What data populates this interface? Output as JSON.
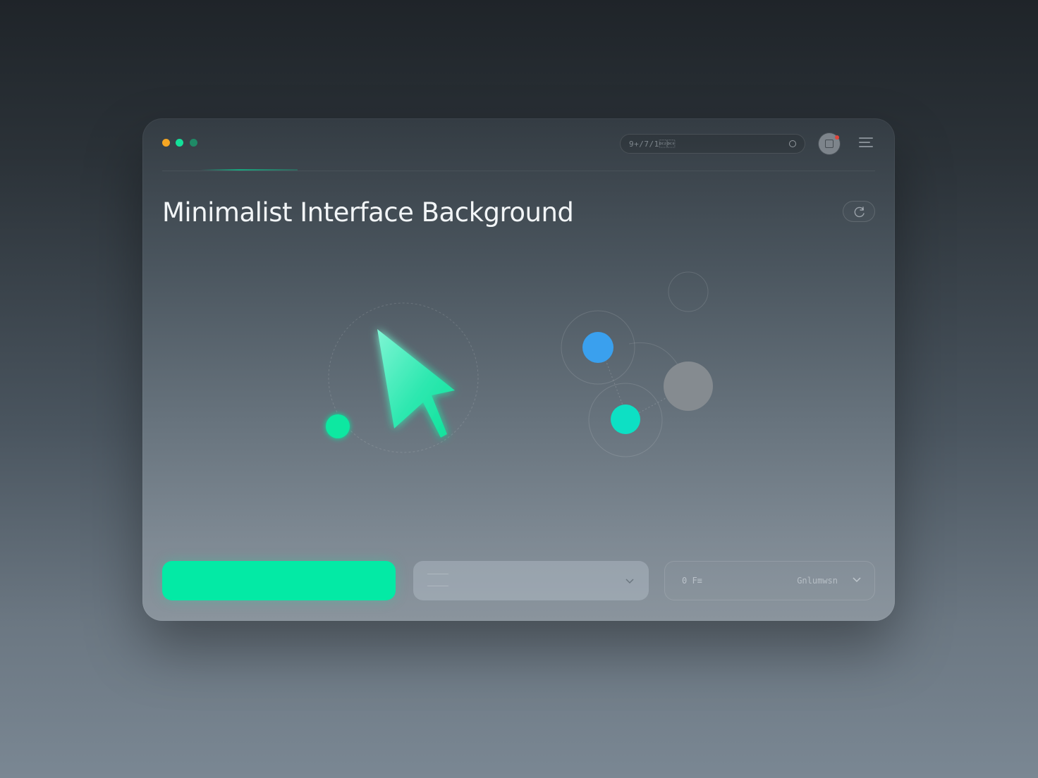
{
  "window": {
    "dots": [
      {
        "name": "orange",
        "color": "#f5a623"
      },
      {
        "name": "green",
        "color": "#14e09a"
      },
      {
        "name": "dark-green",
        "color": "#1f8a66"
      }
    ]
  },
  "header": {
    "search": {
      "value": "9+/7/1\u0012\u0013",
      "display": "9ᴴ/7/1▯▯3",
      "icon": "search-icon"
    },
    "avatar_icon": "avatar-icon",
    "menu_icon": "menu-icon"
  },
  "main": {
    "title": "Minimalist Interface Background",
    "refresh_icon": "refresh-icon"
  },
  "illustration": {
    "cursor_color": "#19e8a8",
    "nodes": [
      {
        "name": "blue-node",
        "color": "#3aa0ee"
      },
      {
        "name": "teal-node",
        "color": "#0de0c4"
      },
      {
        "name": "gray-node",
        "color": "#858b90"
      },
      {
        "name": "green-dot",
        "color": "#0fe8a1"
      }
    ]
  },
  "controls": {
    "primary_button_label": "",
    "select": {
      "value": "",
      "chevron": "chevron-down-icon"
    },
    "filter": {
      "code": "0 F≡",
      "label": "Gnlumwsn",
      "chevron": "chevron-down-icon"
    }
  },
  "colors": {
    "accent": "#03eaa5",
    "blue": "#3aa0ee",
    "teal": "#0de0c4",
    "badge": "#e0463c"
  }
}
